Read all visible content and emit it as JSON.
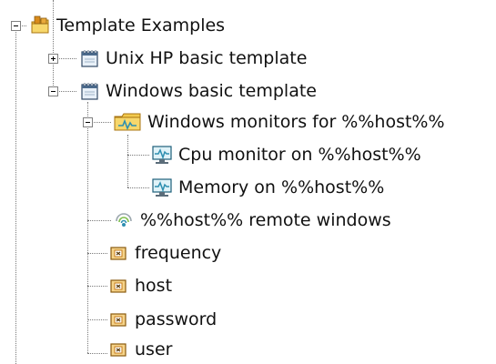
{
  "tree": {
    "root": {
      "label": "Template Examples",
      "icon": "folder-template-icon",
      "expanded": true
    },
    "unix": {
      "label": "Unix HP basic template",
      "icon": "document-template-icon",
      "expanded": false
    },
    "windows": {
      "label": "Windows basic template",
      "icon": "document-template-icon",
      "expanded": true
    },
    "monitors_group": {
      "label": "Windows monitors for %%host%%",
      "icon": "monitor-group-icon",
      "expanded": true
    },
    "cpu": {
      "label": "Cpu monitor on %%host%%",
      "icon": "monitor-icon"
    },
    "memory": {
      "label": "Memory on %%host%%",
      "icon": "monitor-icon"
    },
    "remote": {
      "label": "%%host%% remote windows",
      "icon": "remote-connection-icon"
    },
    "vars": [
      {
        "label": "frequency",
        "icon": "variable-icon"
      },
      {
        "label": "host",
        "icon": "variable-icon"
      },
      {
        "label": "password",
        "icon": "variable-icon"
      },
      {
        "label": "user",
        "icon": "variable-icon"
      }
    ]
  },
  "colors": {
    "connector": "#7a7a7a",
    "folder_yellow": "#f2c94c",
    "folder_orange": "#d98b1c",
    "monitor_teal": "#2f8fb0",
    "variable_orange": "#c47a1a",
    "text": "#111111"
  }
}
